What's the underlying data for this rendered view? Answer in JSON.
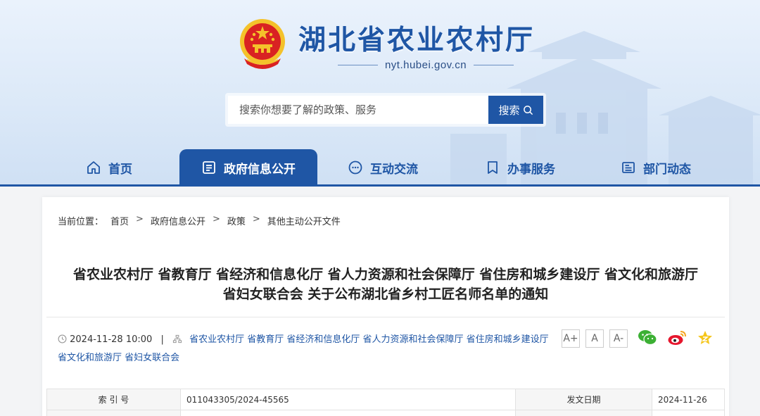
{
  "header": {
    "site_title": "湖北省农业农村厅",
    "domain": "nyt.hubei.gov.cn",
    "search_placeholder": "搜索你想要了解的政策、服务",
    "search_button": "搜索"
  },
  "nav": {
    "items": [
      {
        "label": "首页",
        "icon": "home-icon"
      },
      {
        "label": "政府信息公开",
        "icon": "document-icon",
        "active": true
      },
      {
        "label": "互动交流",
        "icon": "chat-icon"
      },
      {
        "label": "办事服务",
        "icon": "bookmark-icon"
      },
      {
        "label": "部门动态",
        "icon": "news-icon"
      }
    ]
  },
  "breadcrumb": {
    "prefix": "当前位置：",
    "items": [
      "首页",
      "政府信息公开",
      "政策",
      "其他主动公开文件"
    ],
    "separator": ">"
  },
  "article": {
    "title_line1": "省农业农村厅 省教育厅 省经济和信息化厅 省人力资源和社会保障厅 省住房和城乡建设厅 省文化和旅游厅",
    "title_line2": "省妇女联合会 关于公布湖北省乡村工匠名师名单的通知",
    "datetime": "2024-11-28 10:00",
    "meta_separator": "|",
    "publishers_line1": "省农业农村厅 省教育厅 省经济和信息化厅 省人力资源和社会保障厅 省住房和城乡建设厅",
    "publishers_line2": "省文化和旅游厅 省妇女联合会"
  },
  "font_sizes": [
    "A+",
    "A",
    "A-"
  ],
  "share_icons": [
    "wechat-icon",
    "weibo-icon",
    "favorite-icon"
  ],
  "info_table": {
    "rows": [
      {
        "k1": "索 引 号",
        "v1": "011043305/2024-45565",
        "k2": "发文日期",
        "v2": "2024-11-26"
      }
    ]
  },
  "colors": {
    "brand": "#1f56a5",
    "nav_bar": "#1f56a5",
    "background": "#f3f4f6"
  }
}
